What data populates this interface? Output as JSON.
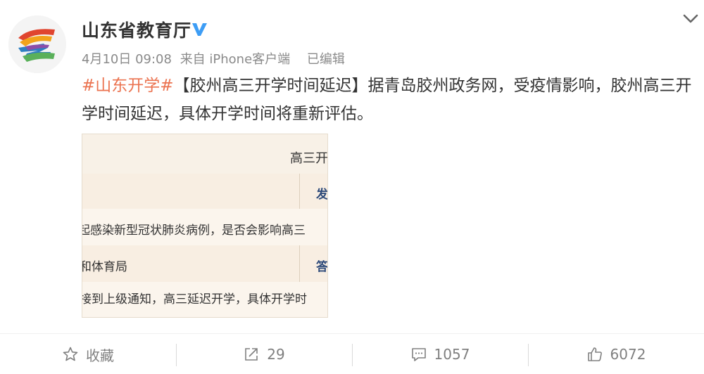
{
  "post": {
    "author": "山东省教育厅",
    "verified_icon": "verified-v-icon",
    "meta": {
      "date": "4月10日 09:08",
      "source": "来自 iPhone客户端",
      "edited": "已编辑"
    },
    "hashtag": "#山东开学#",
    "body": "【胶州高三开学时间延迟】据青岛胶州政务网，受疫情影响，胶州高三开学时间延迟，具体开学时间将重新评估。",
    "image": {
      "title": "高三开",
      "row1_right": "发",
      "row2_text": "起感染新型冠状肺炎病例，是否会影响高三",
      "row3_left": "和体育局",
      "row3_right": "答",
      "row4_text": "接到上级通知，高三延迟开学，具体开学时"
    },
    "actions": {
      "favorite": {
        "label": "收藏",
        "icon": "star-icon"
      },
      "repost": {
        "count": "29",
        "icon": "share-icon"
      },
      "comment": {
        "count": "1057",
        "icon": "comment-icon"
      },
      "like": {
        "count": "6072",
        "icon": "thumbs-up-icon"
      }
    }
  },
  "colors": {
    "hashtag": "#eb7350",
    "text": "#333333",
    "meta": "#8a8a8a",
    "verified": "#3d9df5"
  }
}
